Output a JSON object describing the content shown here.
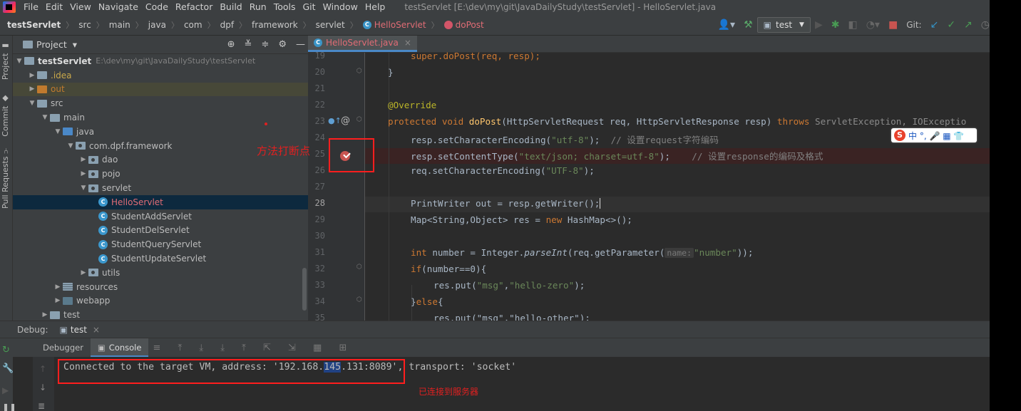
{
  "menu": [
    "File",
    "Edit",
    "View",
    "Navigate",
    "Code",
    "Refactor",
    "Build",
    "Run",
    "Tools",
    "Git",
    "Window",
    "Help"
  ],
  "window_title": "testServlet [E:\\dev\\my\\git\\JavaDailyStudy\\testServlet] - HelloServlet.java",
  "breadcrumbs": [
    "testServlet",
    "src",
    "main",
    "java",
    "com",
    "dpf",
    "framework",
    "servlet",
    "HelloServlet",
    "doPost"
  ],
  "run_config": "test",
  "git_label": "Git:",
  "side_tabs": [
    "Project",
    "Commit",
    "Pull Requests"
  ],
  "project_panel": {
    "title": "Project",
    "root_name": "testServlet",
    "root_path": "E:\\dev\\my\\git\\JavaDailyStudy\\testServlet",
    "items": [
      ".idea",
      "out",
      "src",
      "main",
      "java",
      "com.dpf.framework",
      "dao",
      "pojo",
      "servlet",
      "HelloServlet",
      "StudentAddServlet",
      "StudentDelServlet",
      "StudentQueryServlet",
      "StudentUpdateServlet",
      "utils",
      "resources",
      "webapp",
      "test"
    ]
  },
  "editor_tab": "HelloServlet.java",
  "code_lines": [
    {
      "n": "19",
      "t": "super.doPost(req, resp);"
    },
    {
      "n": "20",
      "t": "}"
    },
    {
      "n": "21",
      "t": ""
    },
    {
      "n": "22",
      "t": "@Override"
    },
    {
      "n": "23",
      "kw1": "protected void ",
      "fn": "doPost",
      "t": "(HttpServletRequest req, HttpServletResponse resp) ",
      "kw2": "throws ",
      "exc": "ServletException, IOExceptio"
    },
    {
      "n": "24",
      "t": "resp.setCharacterEncoding(",
      "s": "\"utf-8\"",
      "t2": ");  ",
      "c": "// 设置request字符编码"
    },
    {
      "n": "25",
      "t": "resp.setContentType(",
      "s": "\"text/json; charset=utf-8\"",
      "t2": ");    ",
      "c": "// 设置response的编码及格式"
    },
    {
      "n": "26",
      "t": "req.setCharacterEncoding(",
      "s": "\"UTF-8\"",
      "t2": ");"
    },
    {
      "n": "27",
      "t": ""
    },
    {
      "n": "28",
      "t": "PrintWriter out = resp.getWriter();"
    },
    {
      "n": "29",
      "t": "Map<String,Object> res = ",
      "kw": "new ",
      "t2": "HashMap<>();"
    },
    {
      "n": "30",
      "t": ""
    },
    {
      "n": "31",
      "kw": "int ",
      "t": "number = Integer.",
      "it": "parseInt",
      "t2": "(req.getParameter(",
      "hint": "name:",
      "s": "\"number\"",
      "t3": "));"
    },
    {
      "n": "32",
      "kw": "if",
      "t": "(number==0){"
    },
    {
      "n": "33",
      "t": "res.put(",
      "s": "\"msg\"",
      "t2": ",",
      "s2": "\"hello-zero\"",
      "t3": ");"
    },
    {
      "n": "34",
      "t": "}",
      "kw": "else",
      "t2": "{"
    },
    {
      "n": "35",
      "t": "res.put(\"msg\",\"hello-other\");"
    }
  ],
  "annotation_breakpoint": "方法打断点",
  "annotation_connected": "已连接到服务器",
  "ime": {
    "logo": "S",
    "text": "中 °, 🎤 ▦ 👕"
  },
  "debug": {
    "label": "Debug:",
    "session": "test",
    "tabs": [
      "Debugger",
      "Console"
    ],
    "console_pre": "Connected to the target VM, address: '192.168.",
    "console_hl": "145",
    "console_post": ".131:8089', transport: 'socket'"
  }
}
